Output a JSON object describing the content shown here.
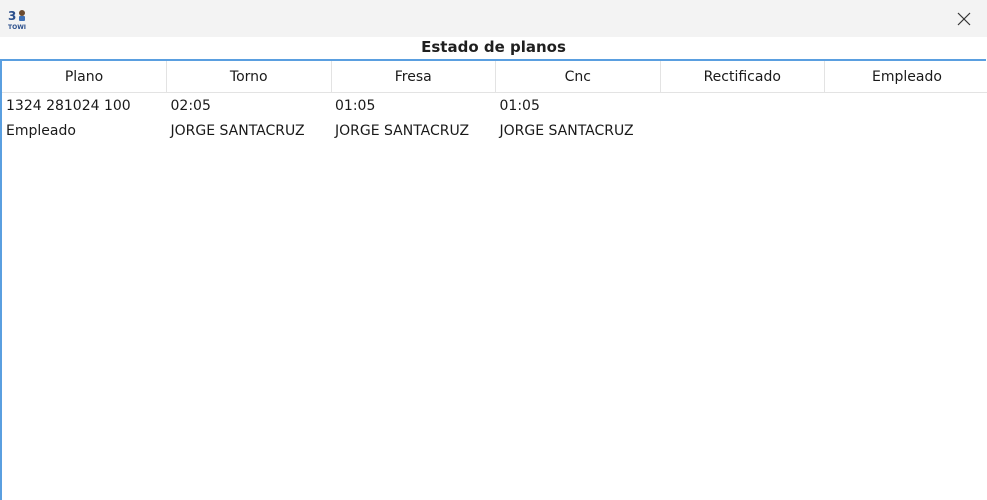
{
  "window": {
    "app_icon": "app-logo-icon",
    "close_icon": "close-icon"
  },
  "form": {
    "title": "Estado de planos"
  },
  "table": {
    "columns": [
      "Plano",
      "Torno",
      "Fresa",
      "Cnc",
      "Rectificado",
      "Empleado"
    ],
    "rows": [
      [
        "1324 281024 100",
        "02:05",
        "01:05",
        "01:05",
        "",
        ""
      ],
      [
        "Empleado",
        "JORGE SANTACRUZ",
        "JORGE SANTACRUZ",
        "JORGE SANTACRUZ",
        "",
        ""
      ]
    ]
  },
  "colors": {
    "titlebar": "#f3f3f3",
    "accent_border": "#5a9fe0"
  }
}
